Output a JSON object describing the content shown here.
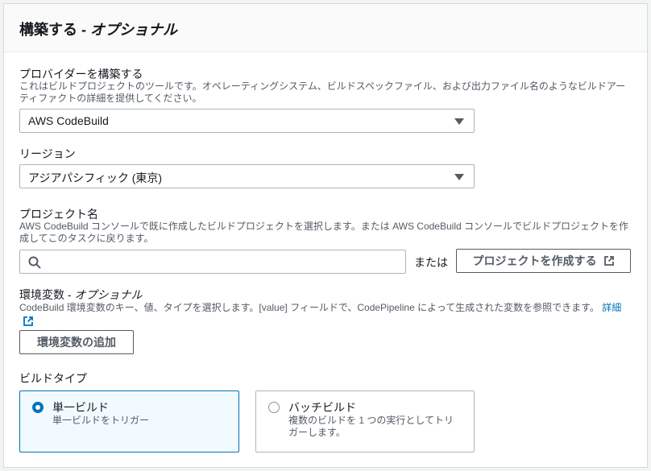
{
  "header": {
    "title": "構築する",
    "title_sep": " - ",
    "title_optional": "オプショナル"
  },
  "build_provider": {
    "label": "プロバイダーを構築する",
    "description_line1": "これはビルドプロジェクトのツールです。オペレーティングシステム、ビルドスペックファイル、および出力ファイル名のようなビルドアー",
    "description_line2": "ティファクトの詳細を提供してください。",
    "selected": "AWS CodeBuild"
  },
  "region": {
    "label": "リージョン",
    "selected": "アジアパシフィック (東京)"
  },
  "project_name": {
    "label": "プロジェクト名",
    "description_line1": "AWS CodeBuild コンソールで既に作成したビルドプロジェクトを選択します。または AWS CodeBuild コンソールでビルドプロジェクトを作",
    "description_line2": "成してこのタスクに戻ります。",
    "search_value": "",
    "or_text": "または",
    "create_button": "プロジェクトを作成する"
  },
  "env_vars": {
    "label": "環境変数",
    "label_sep": " - ",
    "label_optional": "オプショナル",
    "description": "CodeBuild 環境変数のキー、値、タイプを選択します。[value] フィールドで、CodePipeline によって生成された変数を参照できます。",
    "detail_link": "詳細",
    "add_button": "環境変数の追加"
  },
  "build_type": {
    "label": "ビルドタイプ",
    "options": [
      {
        "title": "単一ビルド",
        "description": "単一ビルドをトリガー",
        "selected": true
      },
      {
        "title": "バッチビルド",
        "description_line1": "複数のビルドを 1 つの実行としてトリ",
        "description_line2": "ガーします。",
        "selected": false
      }
    ]
  },
  "colors": {
    "accent": "#0073bb",
    "text": "#16191f",
    "muted": "#545b64",
    "border": "#aab7b8"
  },
  "icons": [
    "search-icon",
    "external-link-icon",
    "caret-down-icon",
    "radio-icon"
  ]
}
